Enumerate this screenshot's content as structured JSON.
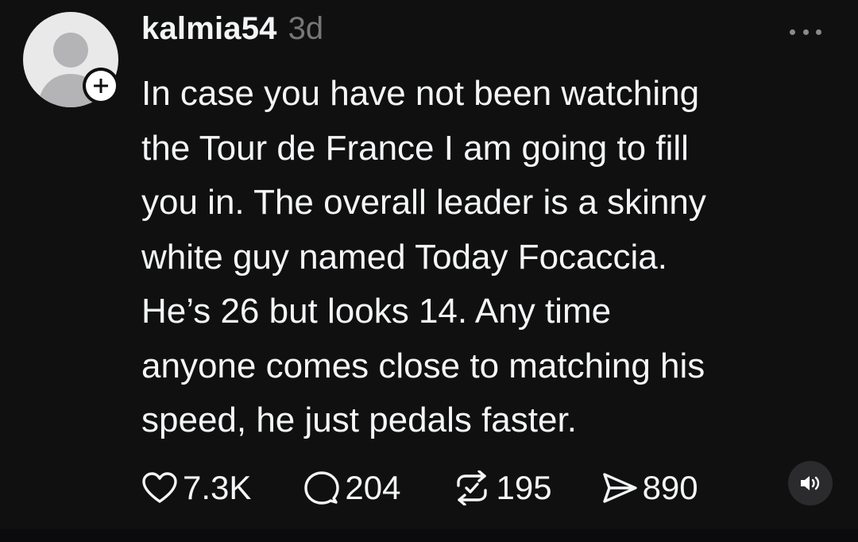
{
  "post": {
    "username": "kalmia54",
    "timestamp": "3d",
    "text": "In case you have not been watching\nthe Tour de France I am going to fill\nyou in. The overall leader is a skinny\nwhite guy named Today Focaccia.\nHe’s 26 but looks 14. Any time\nanyone comes close to matching his\nspeed, he just pedals faster.",
    "actions": {
      "likes": "7.3K",
      "replies": "204",
      "reposts": "195",
      "shares": "890"
    }
  },
  "icons": {
    "avatar": "default-avatar-icon",
    "follow": "plus-icon",
    "more": "more-horizontal-icon",
    "like": "heart-icon",
    "reply": "comment-icon",
    "repost": "repost-icon",
    "share": "send-icon",
    "audio": "speaker-icon"
  },
  "colors": {
    "background": "#101010",
    "text": "#f3f5f7",
    "muted": "#777777"
  }
}
